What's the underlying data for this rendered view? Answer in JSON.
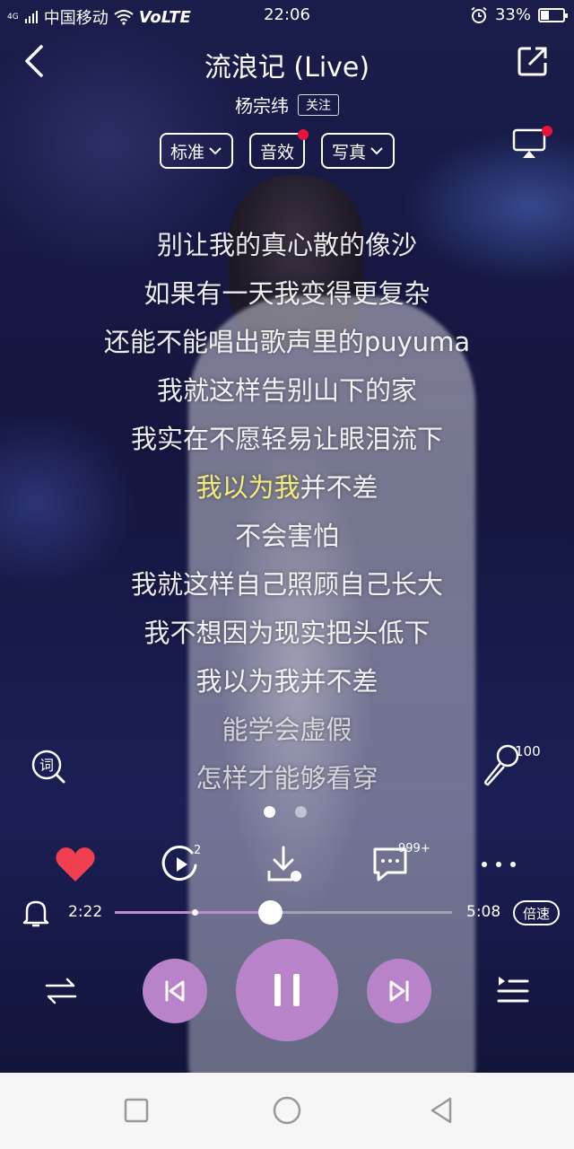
{
  "status_bar": {
    "signal_label": "4G",
    "carrier": "中国移动",
    "volte": "VoLTE",
    "time": "22:06",
    "battery": "33%",
    "battery_level": 0.33,
    "icons": [
      "signal-icon",
      "wifi-icon",
      "alarm-icon",
      "battery-icon"
    ]
  },
  "header": {
    "song_title": "流浪记 (Live)",
    "artist": "杨宗纬",
    "follow_label": "关注"
  },
  "options": {
    "quality_label": "标准",
    "effect_label": "音效",
    "photo_label": "写真"
  },
  "lyrics": {
    "lines": [
      "别让我的真心散的像沙",
      "如果有一天我变得更复杂",
      "还能不能唱出歌声里的puyuma",
      "我就这样告别山下的家",
      "我实在不愿轻易让眼泪流下",
      "我以为我并不差",
      "不会害怕",
      "我就这样自己照顾自己长大",
      "我不想因为现实把头低下",
      "我以为我并不差",
      "能学会虚假",
      "怎样才能够看穿"
    ],
    "current_line_sung": "我以为我",
    "current_line_rest": "并不差"
  },
  "karaoke_count": "100",
  "actions": {
    "share_count": "2",
    "comment_count": "999+"
  },
  "progress": {
    "current_time": "2:22",
    "total_time": "5:08",
    "played_fraction": 0.46,
    "buffered_fraction": 0.23,
    "speed_label": "倍速"
  },
  "colors": {
    "accent": "#b883c8",
    "highlight_lyric": "#f4ec7a",
    "like": "#f04050",
    "badge": "#e8143c"
  }
}
